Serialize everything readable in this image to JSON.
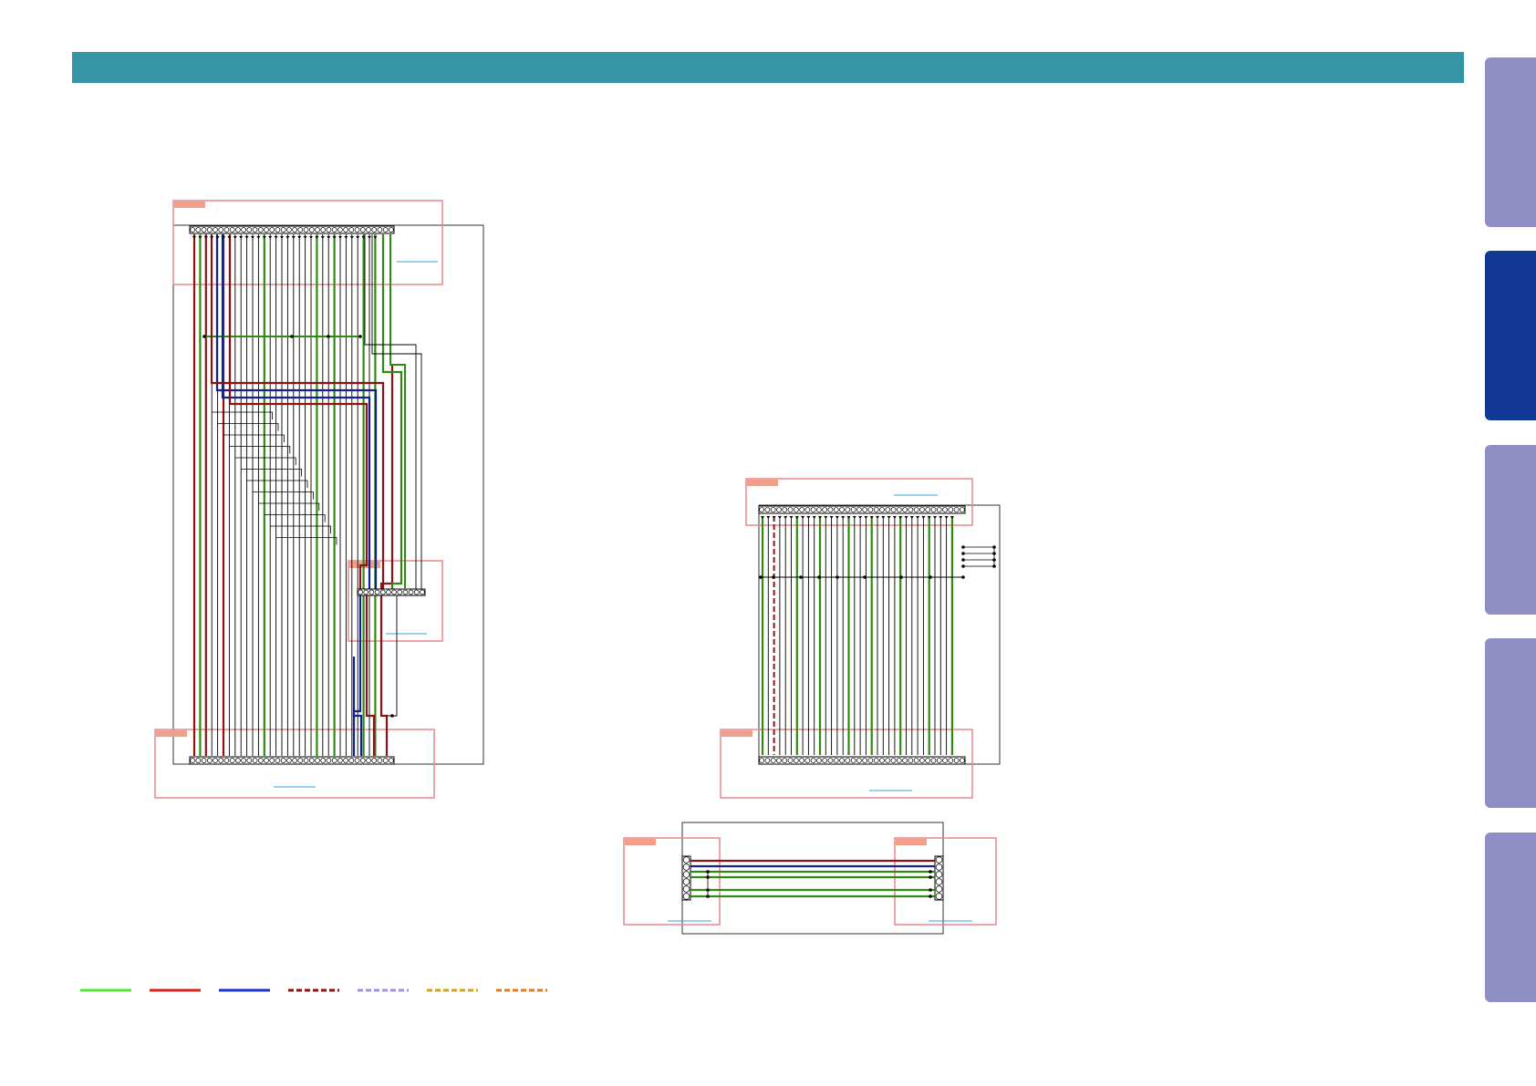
{
  "header": {
    "color": "#3794a6"
  },
  "side_tabs": [
    {
      "name": "side-tab-1",
      "state": "inactive",
      "color": "#8f8fc6"
    },
    {
      "name": "side-tab-2",
      "state": "active",
      "color": "#123895"
    },
    {
      "name": "side-tab-3",
      "state": "inactive",
      "color": "#8f8fc6"
    },
    {
      "name": "side-tab-4",
      "state": "inactive",
      "color": "#8f8fc6"
    },
    {
      "name": "side-tab-5",
      "state": "inactive",
      "color": "#8f8fc6"
    }
  ],
  "colors": {
    "green": "#2f8a12",
    "red": "#8b1313",
    "blue": "#13208f",
    "black": "#000000",
    "box_outline": "#e8868c",
    "box_tag": "#f0a08a",
    "link": "#3aa0d8"
  },
  "legend": [
    {
      "style": "solid",
      "color": "#57e43a"
    },
    {
      "style": "solid",
      "color": "#d8231d"
    },
    {
      "style": "solid",
      "color": "#1c33c8"
    },
    {
      "style": "dashed",
      "color": "#8b1313"
    },
    {
      "style": "dashed",
      "color": "#9d93e6"
    },
    {
      "style": "dashed",
      "color": "#d4a320"
    },
    {
      "style": "dashed",
      "color": "#e07a22"
    }
  ]
}
